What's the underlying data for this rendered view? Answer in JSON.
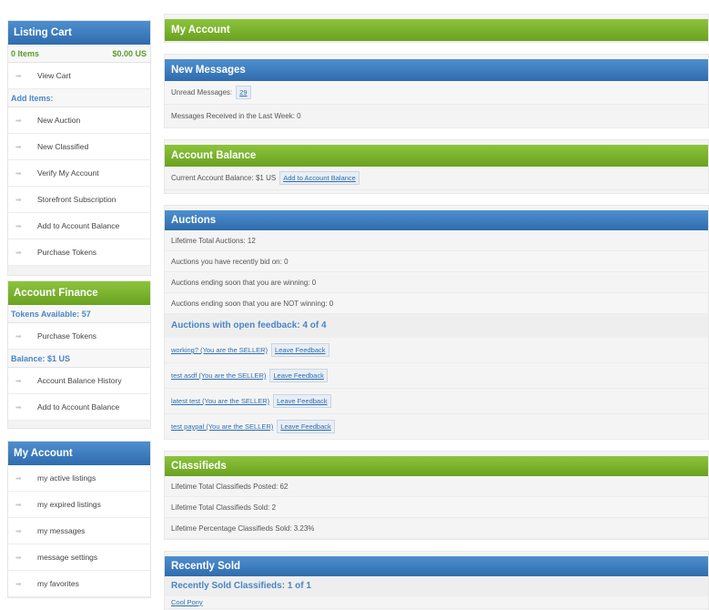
{
  "sidebar": {
    "listing_cart": {
      "title": "Listing Cart",
      "items_count": "0 Items",
      "total": "$0.00 US",
      "view_cart": "View Cart",
      "add_items_label": "Add Items:",
      "add_items": [
        "New Auction",
        "New Classified",
        "Verify My Account",
        "Storefront Subscription",
        "Add to Account Balance",
        "Purchase Tokens"
      ]
    },
    "account_finance": {
      "title": "Account Finance",
      "tokens_label": "Tokens Available: 57",
      "purchase_tokens": "Purchase Tokens",
      "balance_label": "Balance: $1 US",
      "balance_history": "Account Balance History",
      "add_balance": "Add to Account Balance"
    },
    "my_account": {
      "title": "My Account",
      "items": [
        "my active listings",
        "my expired listings",
        "my messages",
        "message settings",
        "my favorites"
      ]
    }
  },
  "main": {
    "title": "My Account",
    "new_messages": {
      "title": "New Messages",
      "unread_label": "Unread Messages:",
      "unread_count": "29",
      "received_week": "Messages Received in the Last Week: 0"
    },
    "account_balance": {
      "title": "Account Balance",
      "current": "Current Account Balance: $1 US",
      "add_button": "Add to Account Balance"
    },
    "auctions": {
      "title": "Auctions",
      "rows": [
        "Lifetime Total Auctions: 12",
        "Auctions you have recently bid on: 0",
        "Auctions ending soon that you are winning: 0",
        "Auctions ending soon that you are NOT winning: 0"
      ],
      "feedback_heading": "Auctions with open feedback: 4 of 4",
      "feedback_button": "Leave Feedback",
      "feedback_items": [
        "working? (You are the SELLER)",
        "test asdf (You are the SELLER)",
        "latest test (You are the SELLER)",
        "test paypal (You are the SELLER)"
      ]
    },
    "classifieds": {
      "title": "Classifieds",
      "rows": [
        "Lifetime Total Classifieds Posted: 62",
        "Lifetime Total Classifieds Sold: 2",
        "Lifetime Percentage Classifieds Sold: 3.23%"
      ]
    },
    "recently_sold": {
      "title": "Recently Sold",
      "subheading": "Recently Sold Classifieds: 1 of 1",
      "first_item": "Cool Pony"
    }
  },
  "colors": {
    "blue_header": "#3a7bbf",
    "green_header": "#7ab42e",
    "link": "#2d6fb3"
  }
}
